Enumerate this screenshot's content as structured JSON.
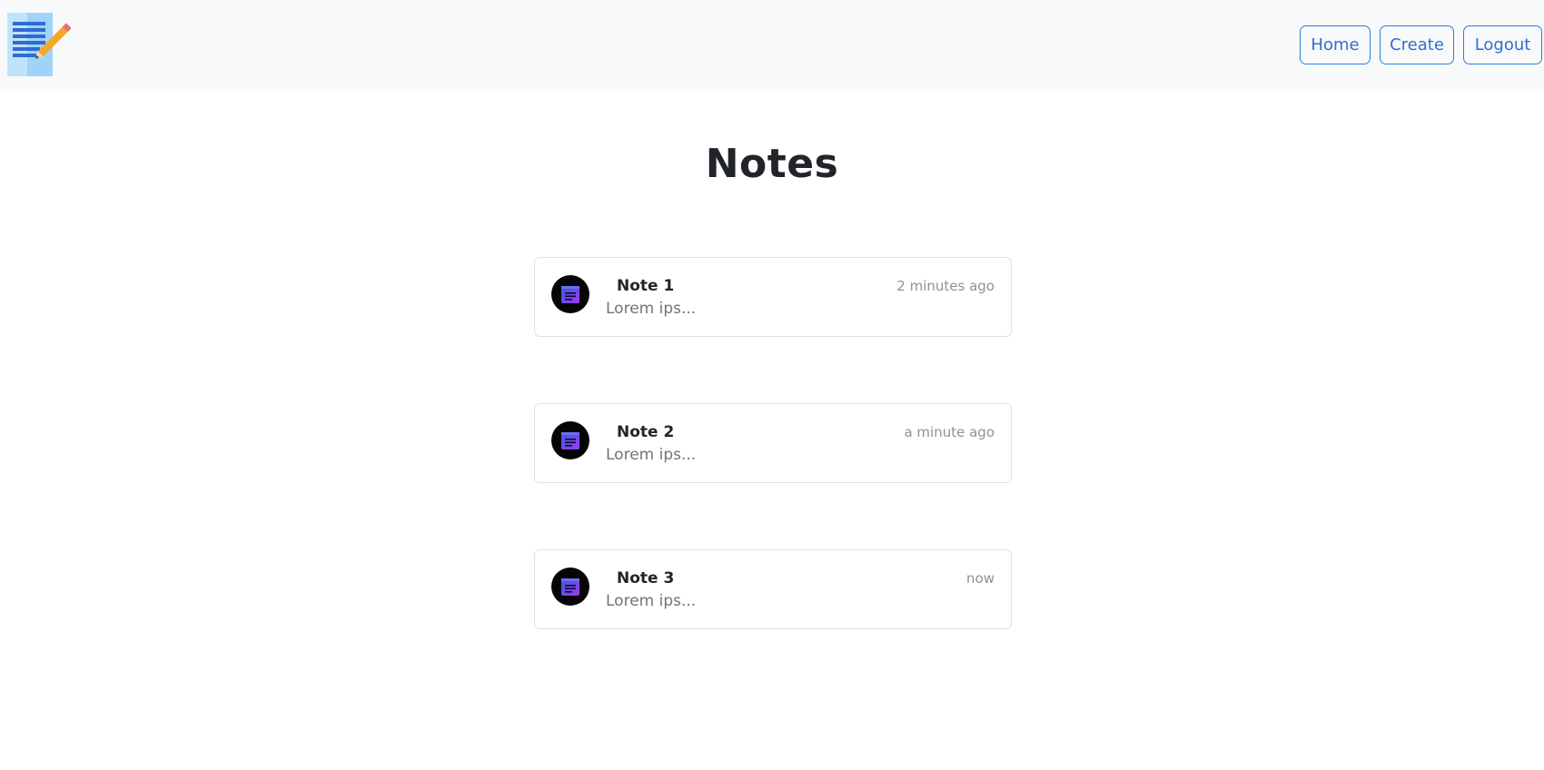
{
  "header": {
    "logo_icon": "notepad-pencil-icon",
    "nav": [
      {
        "label": "Home"
      },
      {
        "label": "Create"
      },
      {
        "label": "Logout"
      }
    ]
  },
  "main": {
    "title": "Notes",
    "notes": [
      {
        "title": "Note 1",
        "preview": "Lorem ips...",
        "time": "2 minutes ago",
        "icon": "note-icon"
      },
      {
        "title": "Note 2",
        "preview": "Lorem ips...",
        "time": "a minute ago",
        "icon": "note-icon"
      },
      {
        "title": "Note 3",
        "preview": "Lorem ips...",
        "time": "now",
        "icon": "note-icon"
      }
    ]
  },
  "colors": {
    "navbar_bg": "#f8f9fa",
    "button_accent": "#2f7be5",
    "avatar_gradient_start": "#3b5bdb",
    "avatar_gradient_end": "#9b3bf0"
  }
}
